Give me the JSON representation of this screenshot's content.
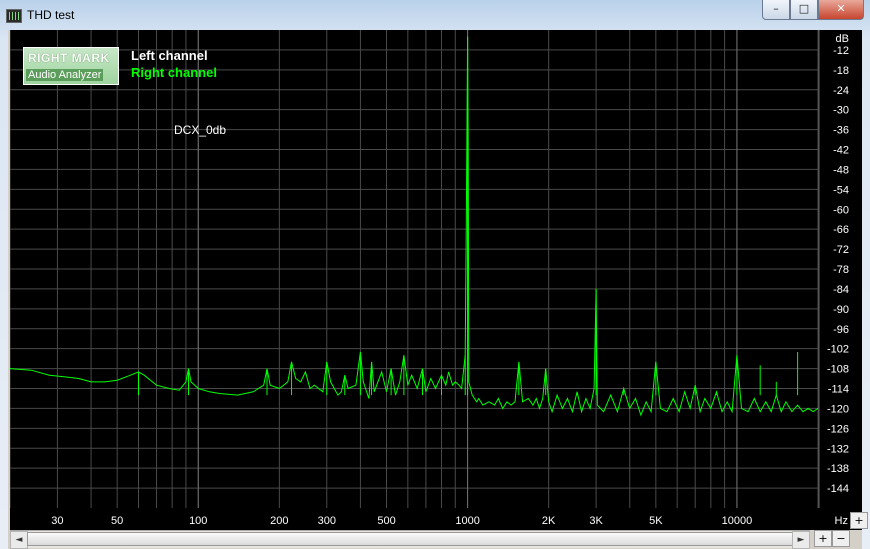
{
  "window": {
    "title": "THD test",
    "controls": {
      "minimize": "–",
      "maximize": "□",
      "close": "✕"
    }
  },
  "logo": {
    "top": "RIGHT MARK",
    "bottom": "Audio Analyzer"
  },
  "legend": [
    {
      "label": "Left channel",
      "color": "#ffffff"
    },
    {
      "label": "Right channel",
      "color": "#00ff00"
    }
  ],
  "annotation": "DCX_0db",
  "chart_data": {
    "type": "line",
    "xscale": "log",
    "xunit": "Hz",
    "yunit": "dB",
    "xlim": [
      20,
      20000
    ],
    "ylim": [
      -150,
      -6
    ],
    "x_ticks": [
      {
        "v": 30,
        "label": "30"
      },
      {
        "v": 50,
        "label": "50"
      },
      {
        "v": 100,
        "label": "100"
      },
      {
        "v": 200,
        "label": "200"
      },
      {
        "v": 300,
        "label": "300"
      },
      {
        "v": 500,
        "label": "500"
      },
      {
        "v": 1000,
        "label": "1000"
      },
      {
        "v": 2000,
        "label": "2K"
      },
      {
        "v": 3000,
        "label": "3K"
      },
      {
        "v": 5000,
        "label": "5K"
      },
      {
        "v": 10000,
        "label": "10000"
      }
    ],
    "y_ticks": [
      -12,
      -18,
      -24,
      -30,
      -36,
      -42,
      -48,
      -54,
      -60,
      -66,
      -72,
      -78,
      -84,
      -90,
      -96,
      -102,
      -108,
      -114,
      -120,
      -126,
      -132,
      -138,
      -144
    ],
    "series": [
      {
        "name": "Right channel",
        "color": "#00ff00",
        "points": [
          [
            20,
            -108
          ],
          [
            24,
            -108.5
          ],
          [
            28,
            -110
          ],
          [
            32,
            -110.5
          ],
          [
            36,
            -111
          ],
          [
            40,
            -112
          ],
          [
            45,
            -112
          ],
          [
            50,
            -111.5
          ],
          [
            56,
            -110
          ],
          [
            60,
            -109
          ],
          [
            63,
            -110
          ],
          [
            70,
            -113
          ],
          [
            78,
            -114
          ],
          [
            85,
            -114.5
          ],
          [
            90,
            -112
          ],
          [
            92,
            -108
          ],
          [
            94,
            -112
          ],
          [
            100,
            -114
          ],
          [
            110,
            -115
          ],
          [
            120,
            -115.5
          ],
          [
            140,
            -116
          ],
          [
            160,
            -115
          ],
          [
            175,
            -113
          ],
          [
            180,
            -108
          ],
          [
            185,
            -113
          ],
          [
            200,
            -114
          ],
          [
            215,
            -112
          ],
          [
            222,
            -106
          ],
          [
            230,
            -111
          ],
          [
            240,
            -112
          ],
          [
            250,
            -109
          ],
          [
            260,
            -114
          ],
          [
            270,
            -113
          ],
          [
            290,
            -115
          ],
          [
            300,
            -106
          ],
          [
            310,
            -112
          ],
          [
            330,
            -116
          ],
          [
            340,
            -115
          ],
          [
            350,
            -110
          ],
          [
            360,
            -114
          ],
          [
            385,
            -113
          ],
          [
            400,
            -103
          ],
          [
            410,
            -112
          ],
          [
            430,
            -117
          ],
          [
            440,
            -106
          ],
          [
            450,
            -115
          ],
          [
            480,
            -109
          ],
          [
            500,
            -115
          ],
          [
            520,
            -108
          ],
          [
            540,
            -116
          ],
          [
            560,
            -112
          ],
          [
            580,
            -104
          ],
          [
            600,
            -113
          ],
          [
            620,
            -110
          ],
          [
            650,
            -114
          ],
          [
            680,
            -108
          ],
          [
            700,
            -115
          ],
          [
            730,
            -111
          ],
          [
            760,
            -114
          ],
          [
            800,
            -110
          ],
          [
            830,
            -113
          ],
          [
            850,
            -109
          ],
          [
            880,
            -113
          ],
          [
            900,
            -112
          ],
          [
            930,
            -113
          ],
          [
            950,
            -114
          ],
          [
            980,
            -104
          ],
          [
            990,
            -60
          ],
          [
            1000,
            -8
          ],
          [
            1005,
            -40
          ],
          [
            1010,
            -112
          ],
          [
            1040,
            -116
          ],
          [
            1080,
            -118
          ],
          [
            1100,
            -117
          ],
          [
            1140,
            -119
          ],
          [
            1200,
            -118
          ],
          [
            1260,
            -119
          ],
          [
            1300,
            -117
          ],
          [
            1350,
            -120
          ],
          [
            1400,
            -118
          ],
          [
            1450,
            -119
          ],
          [
            1500,
            -118
          ],
          [
            1550,
            -106
          ],
          [
            1600,
            -118
          ],
          [
            1680,
            -117
          ],
          [
            1750,
            -119
          ],
          [
            1800,
            -117
          ],
          [
            1850,
            -120
          ],
          [
            1900,
            -117
          ],
          [
            1950,
            -108
          ],
          [
            2000,
            -118
          ],
          [
            2060,
            -121
          ],
          [
            2150,
            -116
          ],
          [
            2250,
            -120
          ],
          [
            2350,
            -117
          ],
          [
            2450,
            -121
          ],
          [
            2550,
            -115
          ],
          [
            2650,
            -121
          ],
          [
            2750,
            -117
          ],
          [
            2850,
            -120
          ],
          [
            2950,
            -114
          ],
          [
            3000,
            -84
          ],
          [
            3030,
            -119
          ],
          [
            3200,
            -121
          ],
          [
            3400,
            -116
          ],
          [
            3600,
            -121
          ],
          [
            3800,
            -114
          ],
          [
            4000,
            -120
          ],
          [
            4200,
            -117
          ],
          [
            4400,
            -122
          ],
          [
            4600,
            -118
          ],
          [
            4800,
            -121
          ],
          [
            5000,
            -106
          ],
          [
            5200,
            -120
          ],
          [
            5500,
            -121
          ],
          [
            5800,
            -117
          ],
          [
            6100,
            -121
          ],
          [
            6400,
            -115
          ],
          [
            6700,
            -120
          ],
          [
            7000,
            -113
          ],
          [
            7300,
            -121
          ],
          [
            7600,
            -117
          ],
          [
            8000,
            -120
          ],
          [
            8400,
            -115
          ],
          [
            8800,
            -121
          ],
          [
            9200,
            -118
          ],
          [
            9600,
            -121
          ],
          [
            10000,
            -104
          ],
          [
            10400,
            -120
          ],
          [
            11000,
            -121
          ],
          [
            11600,
            -117
          ],
          [
            12200,
            -121
          ],
          [
            12800,
            -118
          ],
          [
            13400,
            -121
          ],
          [
            14000,
            -116
          ],
          [
            14600,
            -121
          ],
          [
            15200,
            -118
          ],
          [
            16000,
            -121
          ],
          [
            16800,
            -119
          ],
          [
            17600,
            -121
          ],
          [
            18400,
            -120
          ],
          [
            19200,
            -121
          ],
          [
            20000,
            -120
          ]
        ],
        "spikes": [
          [
            60,
            -109
          ],
          [
            92,
            -108
          ],
          [
            180,
            -108
          ],
          [
            222,
            -106
          ],
          [
            300,
            -106
          ],
          [
            350,
            -110
          ],
          [
            400,
            -103
          ],
          [
            440,
            -106
          ],
          [
            520,
            -108
          ],
          [
            580,
            -104
          ],
          [
            680,
            -108
          ],
          [
            800,
            -110
          ],
          [
            980,
            -104
          ],
          [
            1000,
            -8
          ],
          [
            1550,
            -106
          ],
          [
            1950,
            -108
          ],
          [
            2550,
            -115
          ],
          [
            3000,
            -84
          ],
          [
            3800,
            -114
          ],
          [
            5000,
            -106
          ],
          [
            7000,
            -113
          ],
          [
            8400,
            -115
          ],
          [
            10000,
            -104
          ],
          [
            12200,
            -107
          ],
          [
            14000,
            -112
          ],
          [
            16800,
            -103
          ]
        ]
      }
    ]
  },
  "scroll": {
    "left": "◄",
    "right": "►"
  },
  "zoom": {
    "in_x": "+",
    "out_x": "−",
    "in_y": "+"
  }
}
